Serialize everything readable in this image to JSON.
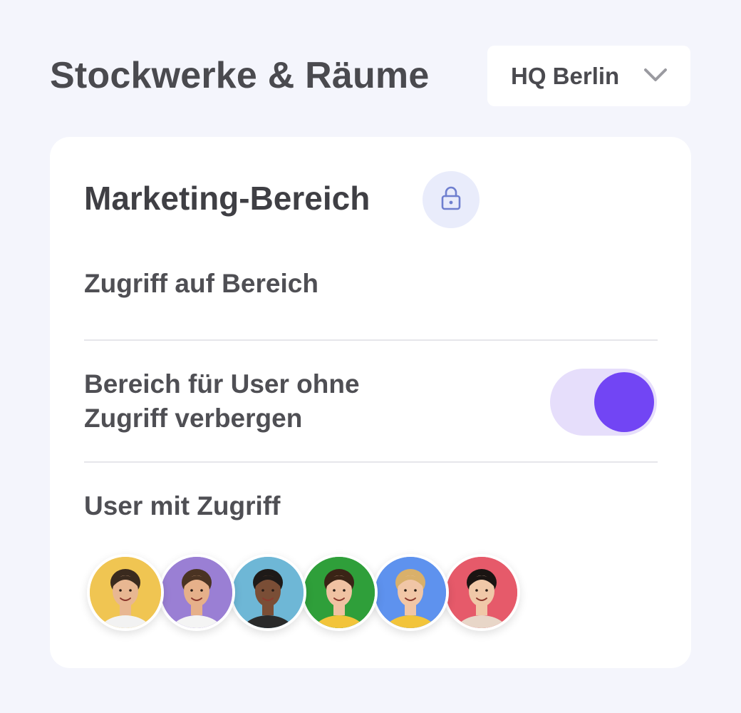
{
  "header": {
    "title": "Stockwerke & Räume",
    "location_select": {
      "value": "HQ Berlin",
      "icon": "chevron-down-icon"
    }
  },
  "card": {
    "title": "Marketing-Bereich",
    "lock_icon": "lock-icon",
    "access_label": "Zugriff auf Bereich",
    "hide_toggle": {
      "label_line1": "Bereich für User ohne",
      "label_line2": "Zugriff verbergen",
      "on": true
    },
    "users_label": "User mit Zugriff",
    "avatars": [
      {
        "bg": "#f0c552",
        "hair": "#3a2a1e",
        "skin": "#e8b792",
        "shirt": "#f2f2f2"
      },
      {
        "bg": "#9a7fd4",
        "hair": "#4a3322",
        "skin": "#e6b08a",
        "shirt": "#f4f4f4"
      },
      {
        "bg": "#6eb7d6",
        "hair": "#1e1a18",
        "skin": "#7a4e36",
        "shirt": "#2a2a2a"
      },
      {
        "bg": "#2f9f3a",
        "hair": "#3a2416",
        "skin": "#f0c2a2",
        "shirt": "#f2c43a"
      },
      {
        "bg": "#5e92ee",
        "hair": "#d9b06a",
        "skin": "#f1c6a6",
        "shirt": "#f2c43a"
      },
      {
        "bg": "#e65a6a",
        "hair": "#1a1412",
        "skin": "#f0c8a8",
        "shirt": "#e8d6c8"
      }
    ]
  },
  "colors": {
    "background": "#f4f5fc",
    "accent": "#7245f4",
    "toggle_track": "#e6defb",
    "lock_badge": "#e9ecfb",
    "lock_icon": "#6f7fcf"
  }
}
